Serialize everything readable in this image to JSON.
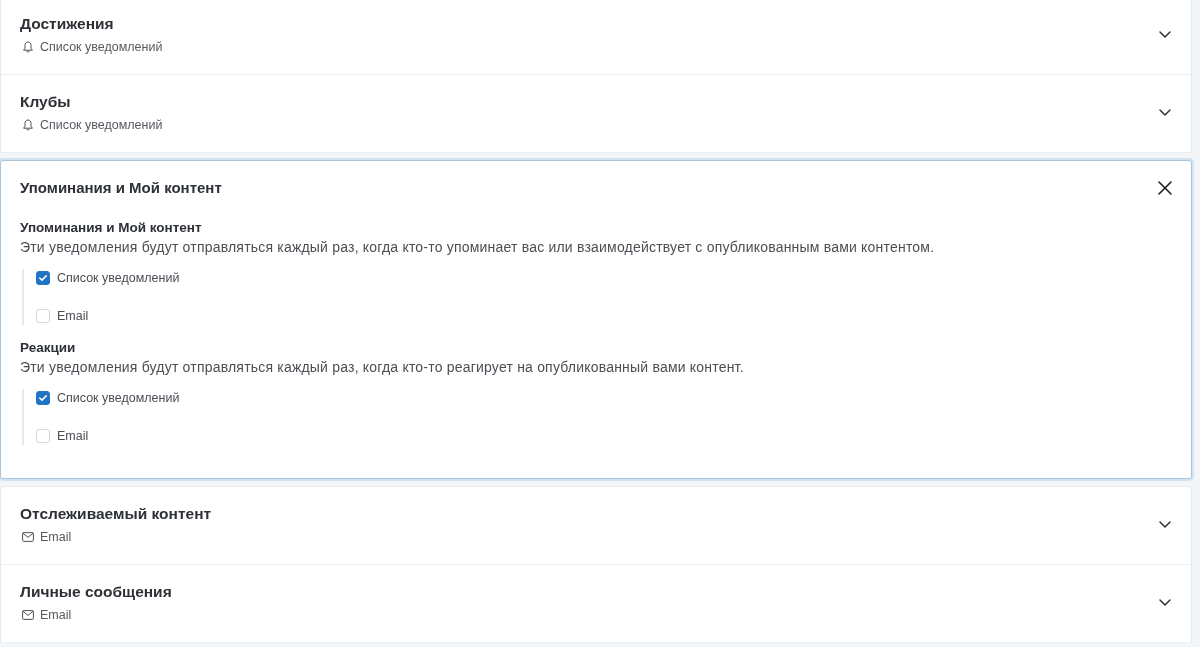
{
  "sections": [
    {
      "title": "Достижения",
      "expanded": false,
      "channels": [
        {
          "kind": "notification",
          "label": "Список уведомлений"
        }
      ]
    },
    {
      "title": "Клубы",
      "expanded": false,
      "channels": [
        {
          "kind": "notification",
          "label": "Список уведомлений"
        }
      ]
    },
    {
      "title": "Упоминания и Мой контент",
      "expanded": true,
      "groups": [
        {
          "title": "Упоминания и Мой контент",
          "description": "Эти уведомления будут отправляться каждый раз, когда кто-то упоминает вас или взаимодействует с опубликованным вами контентом.",
          "options": [
            {
              "label": "Список уведомлений",
              "checked": true
            },
            {
              "label": "Email",
              "checked": false
            }
          ]
        },
        {
          "title": "Реакции",
          "description": "Эти уведомления будут отправляться каждый раз, когда кто-то реагирует на опубликованный вами контент.",
          "options": [
            {
              "label": "Список уведомлений",
              "checked": true
            },
            {
              "label": "Email",
              "checked": false
            }
          ]
        }
      ]
    },
    {
      "title": "Отслеживаемый контент",
      "expanded": false,
      "channels": [
        {
          "kind": "email",
          "label": "Email"
        }
      ]
    },
    {
      "title": "Личные сообщения",
      "expanded": false,
      "channels": [
        {
          "kind": "email",
          "label": "Email"
        }
      ]
    }
  ]
}
